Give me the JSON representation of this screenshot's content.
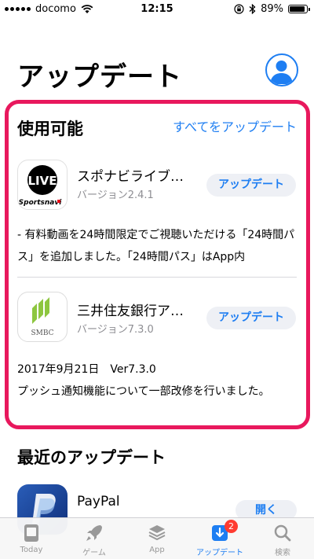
{
  "status_bar": {
    "carrier": "docomo",
    "time": "12:15",
    "battery": "89%",
    "battery_level": 0.89
  },
  "header": {
    "title": "アップデート"
  },
  "available": {
    "title": "使用可能",
    "update_all_label": "すべてをアップデート",
    "apps": [
      {
        "name": "スポナビライブ…",
        "version": "バージョン2.4.1",
        "button_label": "アップデート",
        "icon_text_top": "LIVE",
        "icon_text_brand": "Sportsnavi",
        "notes": "- 有料動画を24時間限定でご視聴いただける「24時間パス」を追加しました。「24時間パス」はApp内"
      },
      {
        "name": "三井住友銀行ア…",
        "version": "バージョン7.3.0",
        "button_label": "アップデート",
        "icon_text": "SMBC",
        "notes_line1": "2017年9月21日　Ver7.3.0",
        "notes_line2": "プッシュ通知機能について一部改修を行いました。"
      }
    ]
  },
  "recent": {
    "title": "最近のアップデート",
    "apps": [
      {
        "name": "PayPal",
        "button_label": "開く"
      }
    ]
  },
  "tab_bar": {
    "tabs": [
      {
        "label": "Today",
        "icon": "today-icon"
      },
      {
        "label": "ゲーム",
        "icon": "rocket-icon"
      },
      {
        "label": "App",
        "icon": "layers-icon"
      },
      {
        "label": "アップデート",
        "icon": "download-icon",
        "badge": "2",
        "active": true
      },
      {
        "label": "検索",
        "icon": "search-icon"
      }
    ]
  },
  "colors": {
    "accent": "#1e7ef2",
    "highlight_border": "#e8185d",
    "badge": "#ff3b30"
  }
}
